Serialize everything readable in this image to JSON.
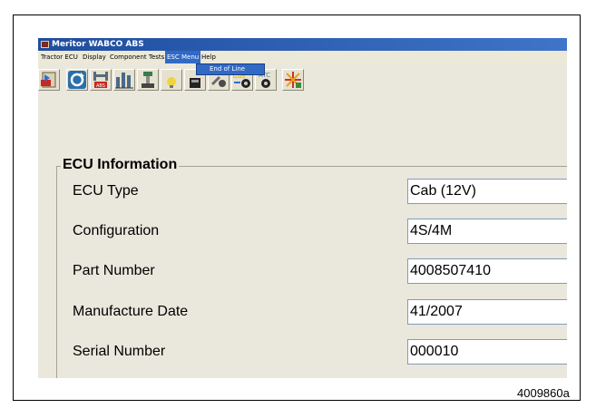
{
  "window": {
    "title": "Meritor WABCO ABS"
  },
  "menubar": {
    "items": [
      {
        "label": "Tractor ECU"
      },
      {
        "label": "Display"
      },
      {
        "label": "Component Tests"
      },
      {
        "label": "ESC Menu",
        "active": true
      },
      {
        "label": "Help"
      }
    ]
  },
  "esc_menu_dropdown": {
    "items": [
      "End of Line"
    ]
  },
  "toolbar": {
    "buttons": [
      {
        "icon": "exit-ecu-icon"
      },
      {
        "icon": "refresh-icon"
      },
      {
        "icon": "abs-valves-icon"
      },
      {
        "icon": "bar-graph-icon"
      },
      {
        "icon": "wheel-speed-sensor-icon"
      },
      {
        "icon": "lamp-icon"
      },
      {
        "icon": "retarder-relay-icon"
      },
      {
        "icon": "pump-icon"
      },
      {
        "icon": "atc-valve-icon"
      },
      {
        "icon": "atc-icon"
      },
      {
        "icon": "diagnostic-flash-icon"
      }
    ]
  },
  "ecu_information": {
    "title": "ECU Information",
    "rows": [
      {
        "label": "ECU Type",
        "value": "Cab (12V)"
      },
      {
        "label": "Configuration",
        "value": "4S/4M"
      },
      {
        "label": "Part Number",
        "value": "4008507410"
      },
      {
        "label": "Manufacture Date",
        "value": "41/2007"
      },
      {
        "label": "Serial Number",
        "value": "000010"
      }
    ]
  },
  "figure_id": "4009860a",
  "colors": {
    "titlebar": "#1f4d9e",
    "menu_active": "#316ac5",
    "dialog_bg": "#eae7dc",
    "field_border": "#7f9db9"
  }
}
